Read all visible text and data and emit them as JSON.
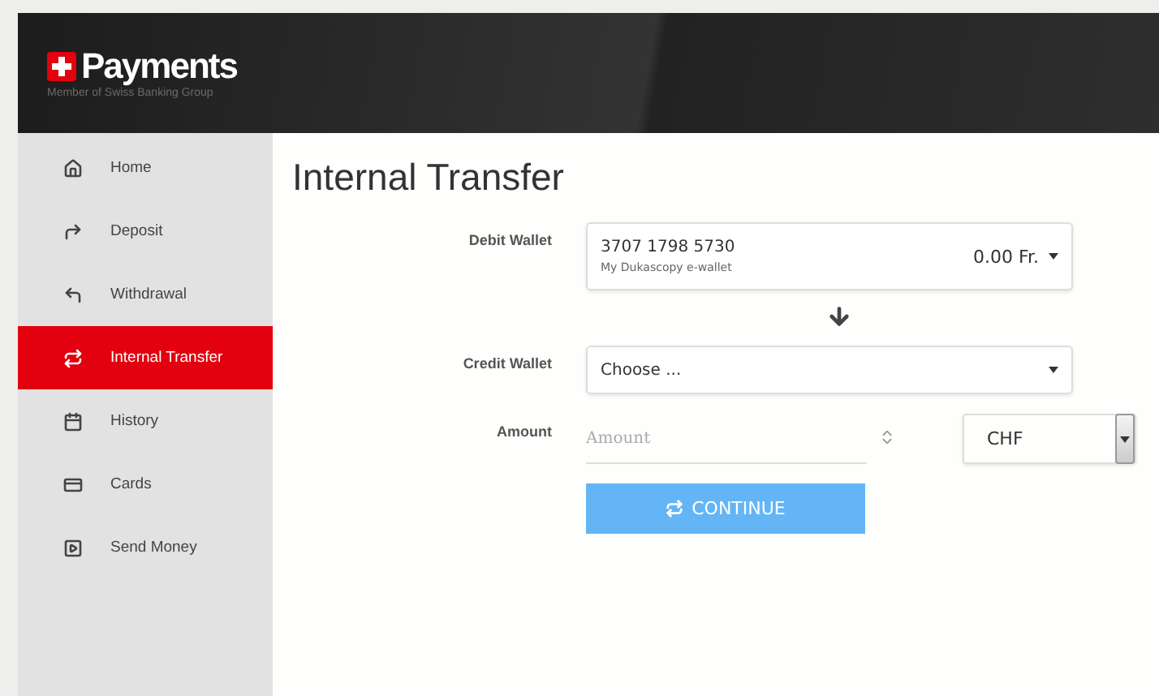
{
  "header": {
    "logo": "Payments",
    "tagline": "Member of Swiss Banking Group"
  },
  "sidebar": {
    "items": [
      {
        "label": "Home",
        "selected": false
      },
      {
        "label": "Deposit",
        "selected": false
      },
      {
        "label": "Withdrawal",
        "selected": false
      },
      {
        "label": "Internal Transfer",
        "selected": true
      },
      {
        "label": "History",
        "selected": false
      },
      {
        "label": "Cards",
        "selected": false
      },
      {
        "label": "Send Money",
        "selected": false
      }
    ]
  },
  "page": {
    "title": "Internal Transfer"
  },
  "form": {
    "debit_wallet": {
      "label": "Debit Wallet",
      "number": "3707 1798 5730",
      "name": "My Dukascopy e-wallet",
      "balance": "0.00 Fr."
    },
    "credit_wallet": {
      "label": "Credit Wallet",
      "value": "Choose ..."
    },
    "amount": {
      "label": "Amount",
      "placeholder": "Amount",
      "currency": "CHF"
    },
    "continue_button": {
      "label": "CONTINUE",
      "disabled": true
    }
  }
}
